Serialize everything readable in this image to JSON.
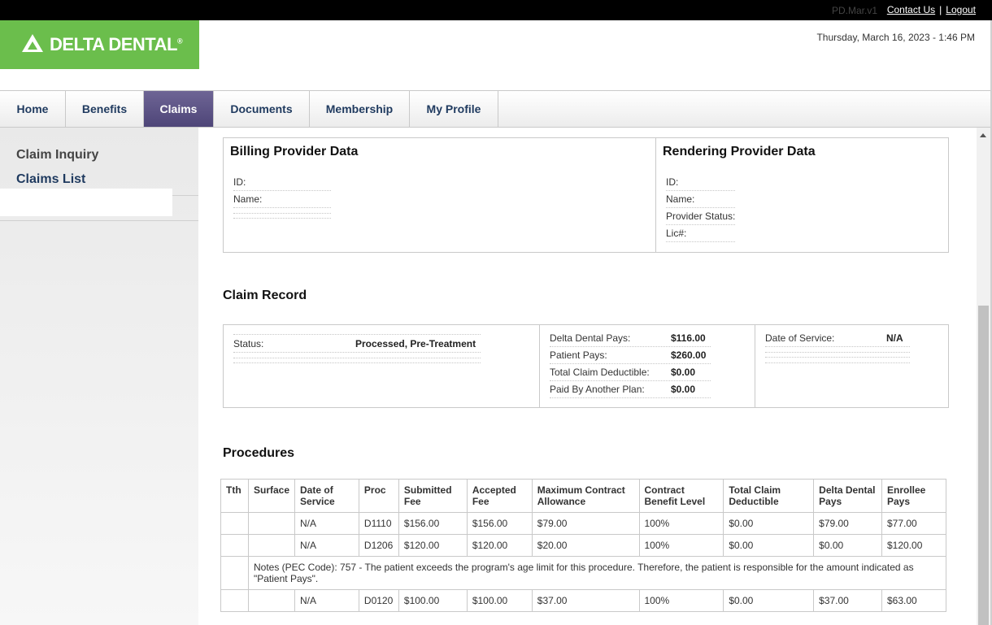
{
  "topbar": {
    "version": "PD.Mar.v1",
    "contact": "Contact Us",
    "separator": "|",
    "logout": "Logout"
  },
  "header": {
    "logo_text": "DELTA DENTAL",
    "logo_mark": "®",
    "datetime": "Thursday, March 16, 2023 - 1:46 PM",
    "brand_color": "#6bbe4c"
  },
  "nav": {
    "tabs": [
      "Home",
      "Benefits",
      "Claims",
      "Documents",
      "Membership",
      "My Profile"
    ],
    "active": "Claims",
    "active_color": "#5a5183"
  },
  "sidebar": {
    "items": [
      "Claim Inquiry",
      "Claims List"
    ]
  },
  "billing": {
    "title": "Billing Provider Data",
    "id_label": "ID:",
    "name_label": "Name:"
  },
  "rendering": {
    "title": "Rendering Provider Data",
    "id_label": "ID:",
    "name_label": "Name:",
    "status_label": "Provider Status:",
    "lic_label": "Lic#:"
  },
  "claim": {
    "title": "Claim Record",
    "status_label": "Status:",
    "status_value": "Processed, Pre-Treatment",
    "dd_pays_label": "Delta Dental Pays:",
    "dd_pays_value": "$116.00",
    "patient_pays_label": "Patient Pays:",
    "patient_pays_value": "$260.00",
    "deductible_label": "Total Claim Deductible:",
    "deductible_value": "$0.00",
    "other_plan_label": "Paid By Another Plan:",
    "other_plan_value": "$0.00",
    "dos_label": "Date of Service:",
    "dos_value": "N/A"
  },
  "procedures": {
    "title": "Procedures",
    "headers": [
      "Tth",
      "Surface",
      "Date of Service",
      "Proc",
      "Submitted Fee",
      "Accepted Fee",
      "Maximum Contract Allowance",
      "Contract Benefit Level",
      "Total Claim Deductible",
      "Delta Dental Pays",
      "Enrollee Pays"
    ],
    "rows": [
      [
        "",
        "",
        "N/A",
        "D1110",
        "$156.00",
        "$156.00",
        "$79.00",
        "100%",
        "$0.00",
        "$79.00",
        "$77.00"
      ],
      [
        "",
        "",
        "N/A",
        "D1206",
        "$120.00",
        "$120.00",
        "$20.00",
        "100%",
        "$0.00",
        "$0.00",
        "$120.00"
      ],
      [
        "",
        "",
        "N/A",
        "D0120",
        "$100.00",
        "$100.00",
        "$37.00",
        "100%",
        "$0.00",
        "$37.00",
        "$63.00"
      ]
    ],
    "note": "Notes (PEC Code): 757 - The patient exceeds the program's age limit for this procedure. Therefore, the patient is responsible for the amount indicated as \"Patient Pays\"."
  }
}
